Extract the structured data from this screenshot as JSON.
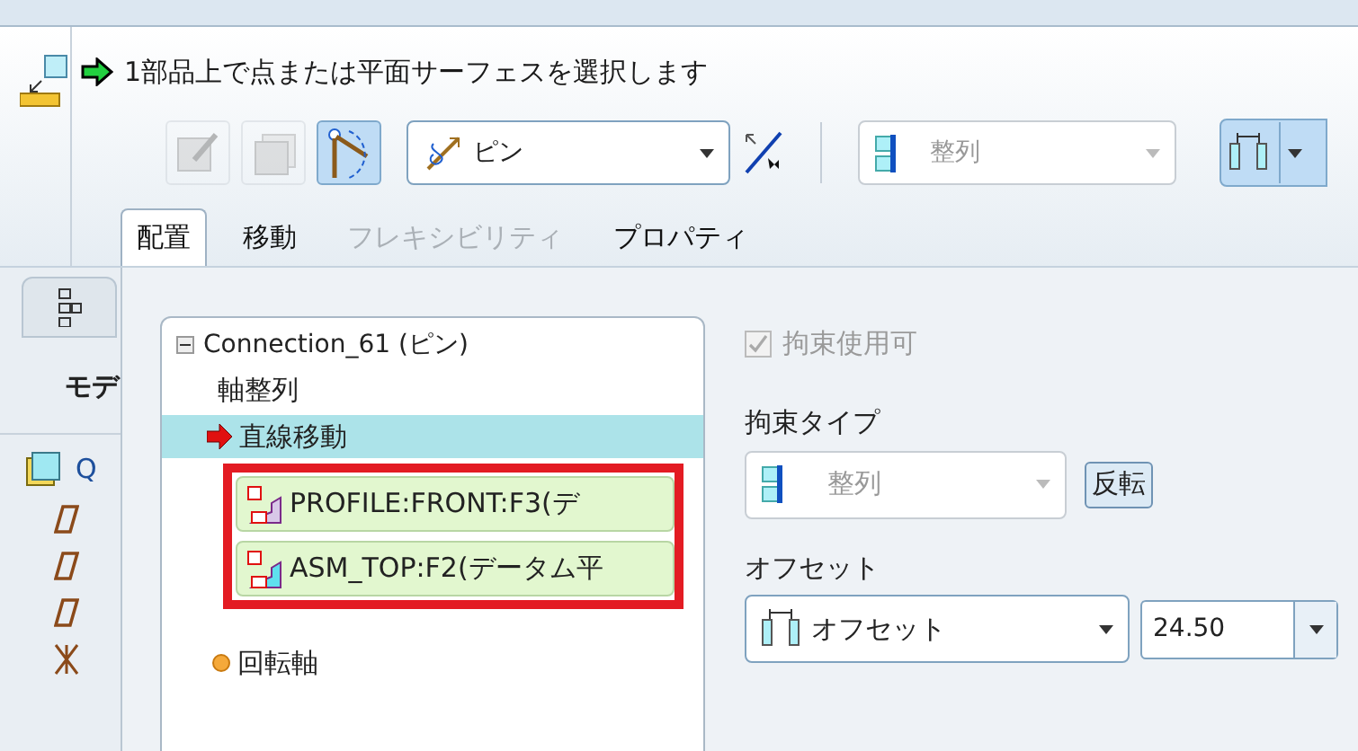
{
  "prompt": {
    "text": "1部品上で点または平面サーフェスを選択します"
  },
  "toolbar": {
    "tools": [
      {
        "kind": "edit",
        "selected": false,
        "disabled": true
      },
      {
        "kind": "copy",
        "selected": false,
        "disabled": true
      },
      {
        "kind": "arc",
        "selected": true,
        "disabled": false
      }
    ],
    "connection_type": {
      "value": "ピン"
    },
    "constraint_type": {
      "value": "整列",
      "disabled": true
    },
    "offset_mode": {
      "selected": true
    }
  },
  "tabs": [
    {
      "label": "配置",
      "selected": true,
      "disabled": false
    },
    {
      "label": "移動",
      "selected": false,
      "disabled": false
    },
    {
      "label": "フレキシビリティ",
      "selected": false,
      "disabled": true
    },
    {
      "label": "プロパティ",
      "selected": false,
      "disabled": false
    }
  ],
  "side_panel": {
    "tab_label": "モデ",
    "tree_root": "Q"
  },
  "tree": {
    "label": "Connection_61 (ピン)",
    "expanded": true,
    "children": [
      {
        "label": "軸整列",
        "kind": "plain",
        "selected": false
      },
      {
        "label": "直線移動",
        "kind": "current",
        "selected": true,
        "references": [
          {
            "label": "PROFILE:FRONT:F3(デ"
          },
          {
            "label": "ASM_TOP:F2(データム平"
          }
        ]
      },
      {
        "label": "回転軸",
        "kind": "pending",
        "selected": false
      }
    ]
  },
  "constraint": {
    "enabled": {
      "label": "拘束使用可",
      "checked": true,
      "disabled": true
    },
    "type_label": "拘束タイプ",
    "type": {
      "value": "整列",
      "disabled": true
    },
    "flip_button": "反転",
    "offset_label": "オフセット",
    "offset_type": {
      "value": "オフセット"
    },
    "offset_value": {
      "value": "24.50"
    }
  }
}
